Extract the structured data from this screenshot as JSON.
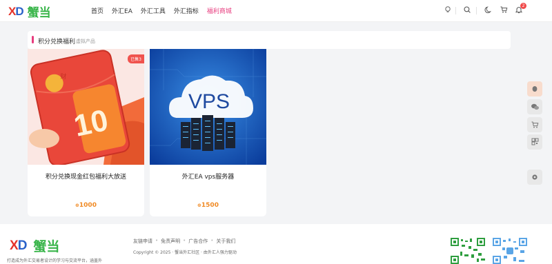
{
  "brand": {
    "logo_mark_x": "X",
    "logo_mark_d": "D",
    "logo_text": "蟹当"
  },
  "nav": {
    "items": [
      {
        "label": "首页"
      },
      {
        "label": "外汇EA"
      },
      {
        "label": "外汇工具"
      },
      {
        "label": "外汇指标"
      },
      {
        "label": "福利商城"
      }
    ],
    "active_index": 4
  },
  "header": {
    "notification_count": "2"
  },
  "section": {
    "title": "积分兑换福利",
    "subtitle": "虚拟产品"
  },
  "products": [
    {
      "name": "积分兑换现金红包福利大放送",
      "price_symbol": "⊕",
      "price": "1000",
      "sold_tag": "已售3",
      "thumb_text": "10",
      "thumb_yen": "¥",
      "thumb_seal": "财"
    },
    {
      "name": "外汇EA vps服务器",
      "price_symbol": "⊕",
      "price": "1500",
      "thumb_text": "VPS"
    }
  ],
  "footer": {
    "logo_mark_x": "X",
    "logo_mark_d": "D",
    "logo_text": "蟹当",
    "description": "打造成为外汇交易者设计的学习与交流平台，涵盖外",
    "links": [
      "友链申请",
      "免责声明",
      "广告合作",
      "关于我们"
    ],
    "copyright": "Copyright © 2025 · 蟹当外汇社区 · 由外汇人强力驱动"
  },
  "colors": {
    "accent": "#e73c7e",
    "price": "#f08a24",
    "logo_green": "#39b54a",
    "logo_red": "#e5332a",
    "logo_blue": "#2a62c9"
  },
  "icons": [
    "bulb-icon",
    "search-icon",
    "moon-icon",
    "cart-icon",
    "bell-icon",
    "qq-icon",
    "wechat-icon",
    "cart-icon",
    "qrcode-icon",
    "settings-icon"
  ]
}
